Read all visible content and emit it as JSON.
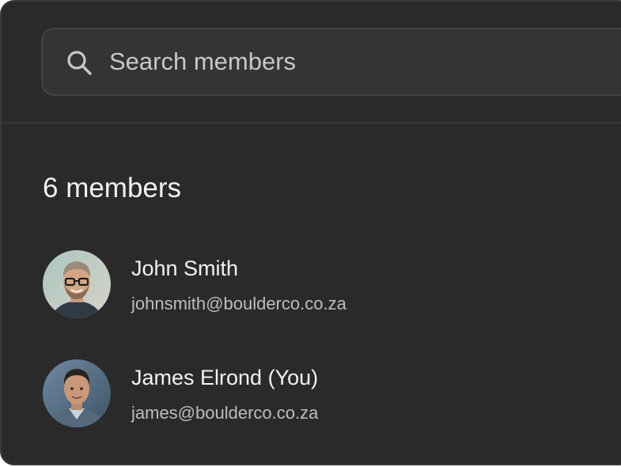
{
  "search": {
    "placeholder": "Search members",
    "icon": "search-icon"
  },
  "members_count_label": "6 members",
  "members": [
    {
      "name": "John Smith",
      "email": "johnsmith@boulderco.co.za",
      "avatar": "avatar-photo"
    },
    {
      "name": "James Elrond (You)",
      "email": "james@boulderco.co.za",
      "avatar": "avatar-photo"
    }
  ],
  "colors": {
    "background": "#2a2a2a",
    "search_background": "#343434",
    "text_primary": "#f2f2f2",
    "text_secondary": "#bdbdbd"
  }
}
